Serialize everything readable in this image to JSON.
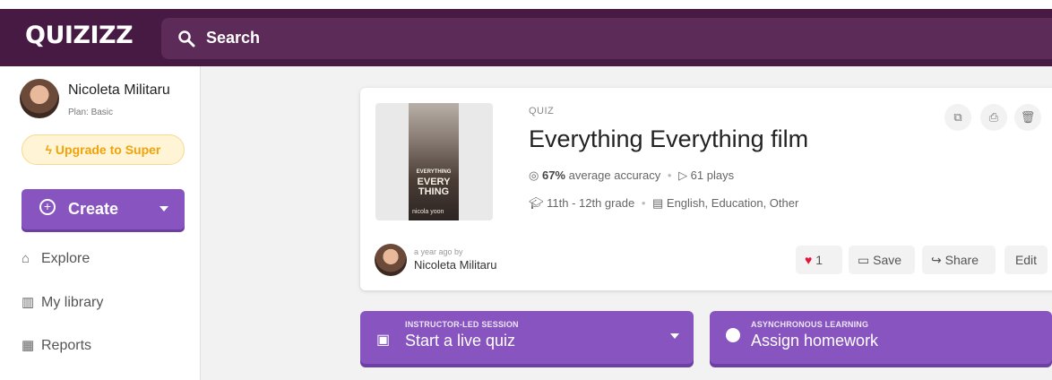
{
  "app": {
    "logo": "QUIZIZZ",
    "search_label": "Search"
  },
  "sidebar": {
    "user_name": "Nicoleta Militaru",
    "plan": "Plan: Basic",
    "upgrade_label": "Upgrade to Super",
    "create_label": "Create",
    "items": [
      {
        "label": "Explore",
        "icon": "explore-icon"
      },
      {
        "label": "My library",
        "icon": "library-icon"
      },
      {
        "label": "Reports",
        "icon": "reports-icon"
      }
    ]
  },
  "quiz": {
    "type": "QUIZ",
    "title": "Everything Everything film",
    "accuracy": "67%",
    "accuracy_label": "average accuracy",
    "plays": "61 plays",
    "grade": "11th - 12th grade",
    "subjects": "English, Education, Other",
    "cover_title_1": "EVERYTHING",
    "cover_title_2": "EVERY",
    "cover_title_3": "THING",
    "cover_author": "nicola yoon",
    "created_ago": "a year ago by",
    "author": "Nicoleta Militaru",
    "likes": "1",
    "save_label": "Save",
    "share_label": "Share",
    "edit_label": "Edit"
  },
  "actions": {
    "live": {
      "small": "INSTRUCTOR-LED SESSION",
      "label": "Start a live quiz"
    },
    "homework": {
      "small": "ASYNCHRONOUS LEARNING",
      "label": "Assign homework"
    }
  },
  "colors": {
    "topbar": "#461a42",
    "search": "#5d2b57",
    "primary": "#8854c0",
    "upgrade": "#f0a30a",
    "like": "#e4143d"
  }
}
